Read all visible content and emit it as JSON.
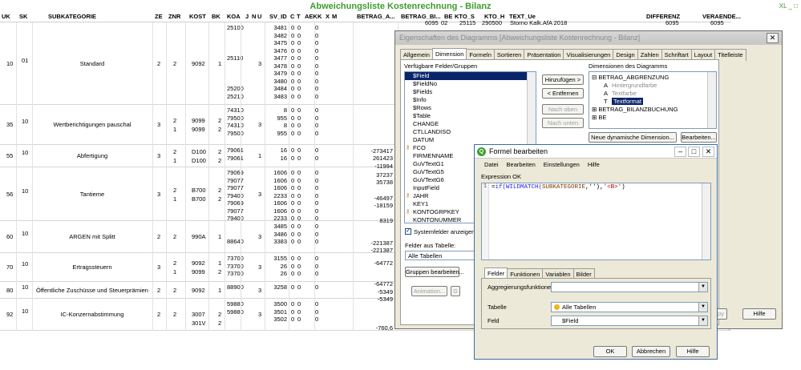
{
  "sheet": {
    "title": "Abweichungsliste Kostenrechnung - Bilanz",
    "icons": "XL _ □",
    "columns": [
      "UK",
      "SK",
      "SUBKATEGORIE",
      "ZE",
      "ZNR",
      "KOST",
      "BK",
      "KOA",
      "J",
      "N",
      "U",
      "SV_ID",
      "C",
      "T",
      "AEK",
      "K",
      "X",
      "M",
      "BETRAG_A...",
      "BETRAG_BI...",
      "BE",
      "KTO_S",
      "KTO_H",
      "TEXT_Ue",
      "DIFFERENZ",
      "VERAENDE..."
    ],
    "groups": [
      {
        "uk": "10",
        "sk": "01",
        "sub": "Standard",
        "ze": "2",
        "znr": "2",
        "kost": "9092",
        "bk": "1",
        "koa": [
          "25100",
          "",
          "",
          "",
          "25110",
          "",
          "",
          "",
          "25200",
          "25210"
        ],
        "u": "3",
        "svid": [
          "3481",
          "3482",
          "3475",
          "3476",
          "3477",
          "3478",
          "3479",
          "3480",
          "3484",
          "3483"
        ]
      },
      {
        "uk": "35",
        "sk": "10",
        "sub": "Wertberichtigungen pauschal",
        "ze": "3",
        "znr": "2\n1",
        "kost": "9099\n9099",
        "bk": "2\n2",
        "koa": [
          "74310",
          "79500",
          "74310",
          "79500"
        ],
        "u": "3",
        "svid": [
          "8",
          "955",
          "8",
          "955"
        ]
      },
      {
        "uk": "55",
        "sk": "10",
        "sub": "Abfertigung",
        "ze": "3",
        "znr": "2\n1",
        "kost": "D100\nD100",
        "bk": "2\n2",
        "koa": [
          "79061",
          "79061"
        ],
        "u": "1",
        "svid": [
          "16",
          "16"
        ]
      },
      {
        "uk": "56",
        "sk": "10",
        "sub": "Tantieme",
        "ze": "3",
        "znr": "2\n1",
        "kost": "B700\nB700",
        "bk": "2\n2",
        "koa": [
          "79069",
          "79077",
          "79077",
          "79400",
          "79069",
          "79077",
          "79400"
        ],
        "u": "3",
        "svid": [
          "1606",
          "1606",
          "1606",
          "2233",
          "1606",
          "1606",
          "2233"
        ]
      },
      {
        "uk": "60",
        "sk": "10",
        "sub": "ARGEN mit Splitt",
        "ze": "2",
        "znr": "2",
        "kost": "990A",
        "bk": "1",
        "koa": [
          "",
          "",
          "88640"
        ],
        "u": "3",
        "svid": [
          "3485",
          "3486",
          "3383"
        ]
      },
      {
        "uk": "70",
        "sk": "10",
        "sub": "Ertragssteuern",
        "ze": "3",
        "znr": "2\n1",
        "kost": "9092\n9099",
        "bk": "1\n2",
        "koa": [
          "73700",
          "73700",
          "73700"
        ],
        "u": "3",
        "svid": [
          "3155",
          "26",
          "26"
        ]
      },
      {
        "uk": "80",
        "sk": "10",
        "sub": "Öffentliche Zuschüsse und Steuerprämien",
        "ze": "2",
        "znr": "2",
        "kost": "9092",
        "bk": "1",
        "koa": [
          "88900"
        ],
        "u": "3",
        "svid": [
          "3258"
        ]
      },
      {
        "uk": "92",
        "sk": "10",
        "sub": "IC-Konzernabstimmung",
        "ze": "2",
        "znr": "2",
        "kost": "3007\n301V",
        "bk": "2\n2",
        "koa": [
          "59880",
          "59880"
        ],
        "u": "3",
        "svid": [
          "3500",
          "3501",
          "3502"
        ]
      }
    ],
    "betrag_a": [
      "-273417",
      "261423",
      "-11994",
      "37237",
      "35738",
      "-46497",
      "-18159",
      "8319",
      "-221387",
      "-221387",
      "-64772",
      "-64772",
      "-5349",
      "-5349",
      "-760,6"
    ],
    "row1": {
      "betrag_bi": "6095",
      "be": "02",
      "kto_s": "25115",
      "kto_h": "290500",
      "text": "Storno Kalk.AfA 2018",
      "diff": "6095",
      "verae": "6095"
    },
    "footer_right": "6,6"
  },
  "props_dialog": {
    "title": "Eigenschaften des Diagramms [Abweichungsliste Kostenrechnung - Bilanz]",
    "tabs": [
      "Allgemein",
      "Dimension",
      "Formeln",
      "Sortieren",
      "Präsentation",
      "Visualisierungen",
      "Design",
      "Zahlen",
      "Schriftart",
      "Layout",
      "Titelleiste"
    ],
    "active_tab": "Dimension",
    "available_label": "Verfügbare Felder/Gruppen",
    "available_fields": [
      "$Field",
      "$FieldNo",
      "$Fields",
      "$Info",
      "$Rows",
      "$Table",
      "CHANGE",
      "CTLLANDISO",
      "DATUM",
      "FCO",
      "FIRMENNAME",
      "GuVTextG1",
      "GuVTextG5",
      "GuVTextG6",
      "InputField",
      "JAHR",
      "KEY1",
      "KONTOGRPKEY",
      "KONTONUMMER"
    ],
    "key_fields": [
      "FCO",
      "JAHR",
      "KONTOGRPKEY"
    ],
    "btn_add": "Hinzufügen >",
    "btn_remove": "< Entfernen",
    "btn_up": "Nach oben",
    "btn_down": "Nach unten",
    "dims_label": "Dimensionen des Diagramms",
    "dims_tree": [
      "BETRAG_ABGRENZUNG",
      "Hintergrundfarbe",
      "Textfarbe",
      "Textformat",
      "BETRAG_BILANZBUCHUNG",
      "BE"
    ],
    "btn_new_dim": "Neue dynamische Dimension...",
    "btn_edit": "Bearbeiten...",
    "chk_system": "Systemfelder anzeigen",
    "tables_label": "Felder aus Tabelle:",
    "tables_value": "Alle Tabellen",
    "btn_groups": "Gruppen bearbeiten...",
    "btn_anim": "Animation...",
    "btn_g": "G",
    "btn_apply": "py",
    "btn_help": "Hilfe"
  },
  "formula_dialog": {
    "title": "Formel bearbeiten",
    "menu": [
      "Datei",
      "Bearbeiten",
      "Einstellungen",
      "Hilfe"
    ],
    "status": "Expression OK",
    "line_no": "1",
    "code_prefix": "=",
    "code_fn1": "if(WILDMATCH(",
    "code_field": "SUBKATEGORIE",
    "code_mid": ",''),",
    "code_str": "'<B>'",
    "code_end": ")",
    "tabs": [
      "Felder",
      "Funktionen",
      "Variablen",
      "Bilder"
    ],
    "aggr_label": "Aggregierungsfunktionen",
    "aggr_value": "",
    "table_label": "Tabelle",
    "table_value": "Alle Tabellen",
    "field_label": "Feld",
    "field_value": "$Field",
    "btn_ok": "OK",
    "btn_cancel": "Abbrechen",
    "btn_help": "Hilfe"
  }
}
